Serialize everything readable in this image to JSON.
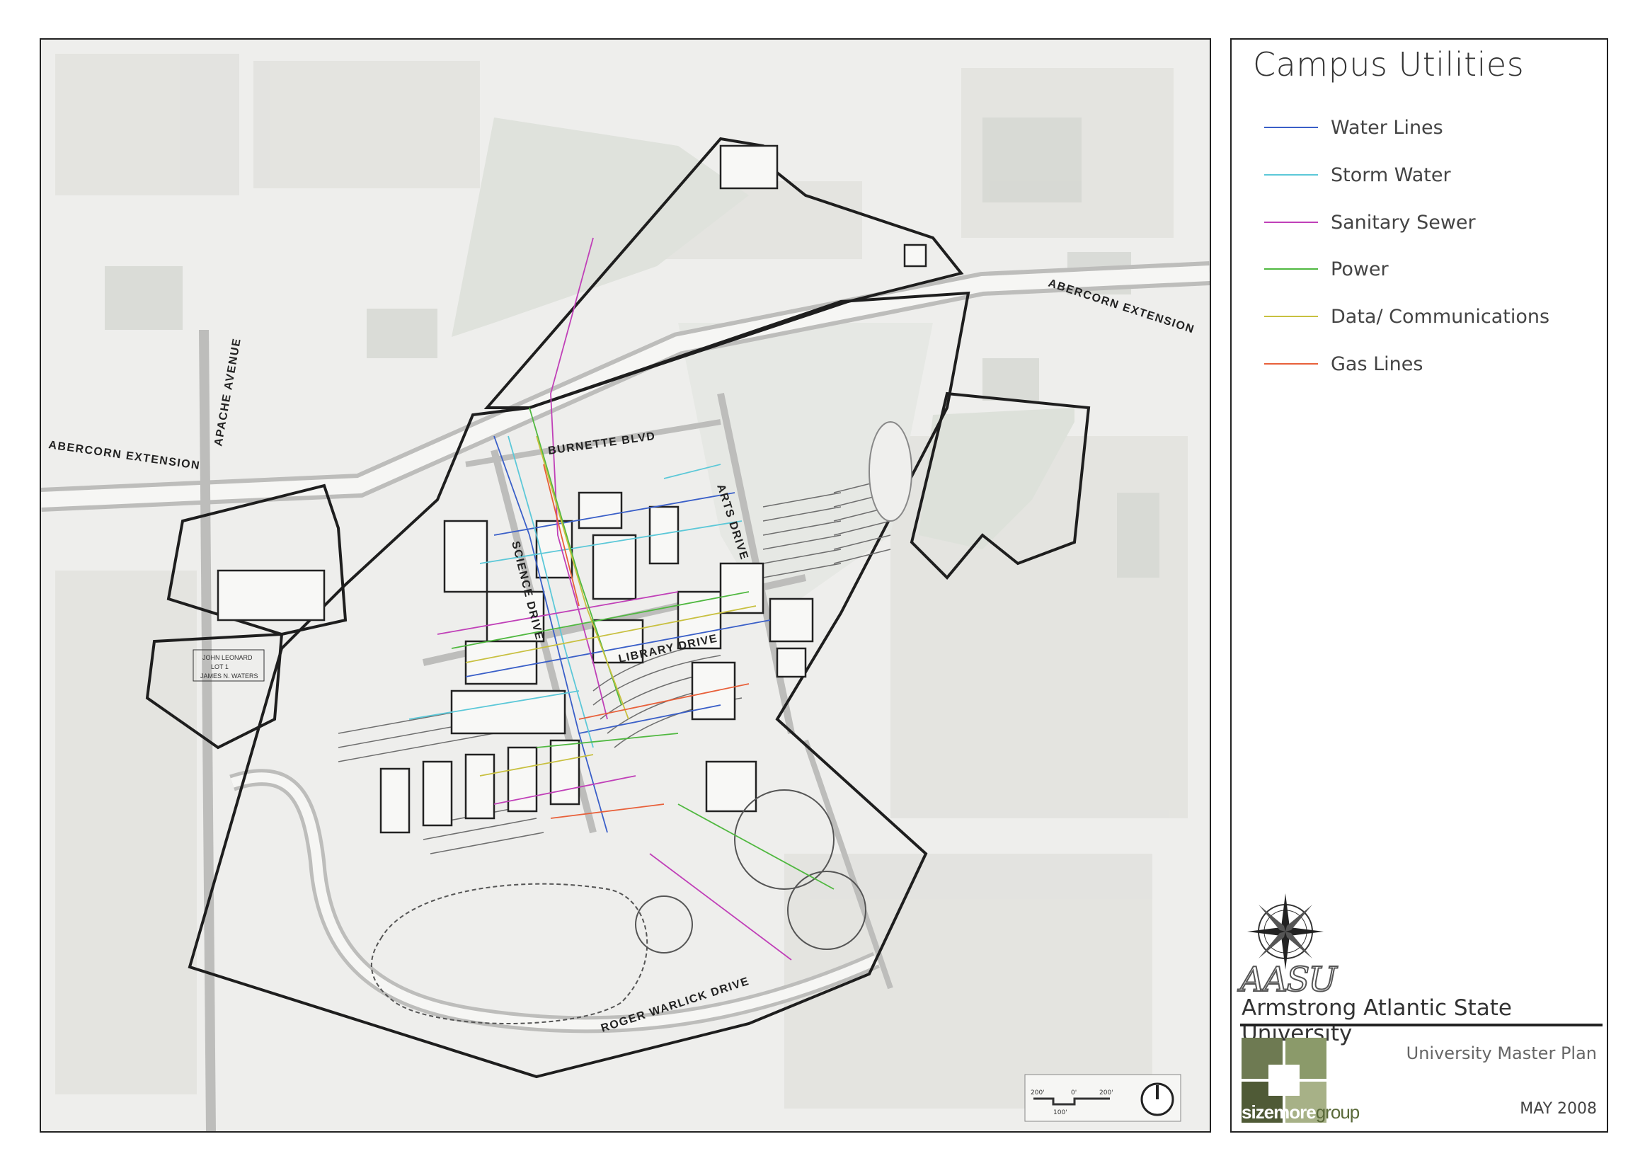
{
  "map": {
    "road_labels": {
      "abercorn_west": "ABERCORN EXTENSION",
      "abercorn_east": "ABERCORN EXTENSION",
      "apache": "APACHE AVENUE",
      "burnette": "BURNETTE BLVD",
      "arts": "ARTS DRIVE",
      "science": "SCIENCE DRIVE",
      "library": "LIBRARY DRIVE",
      "roger_warlick": "ROGER WARLICK DRIVE"
    },
    "parcel_labels": [
      "JOHN LEONARD",
      "LOT 1",
      "JAMES N. WATERS"
    ],
    "scale_bar": {
      "labels": [
        "200'",
        "0'",
        "200'",
        "100'"
      ]
    }
  },
  "legend": {
    "title": "Campus Utilities",
    "items": [
      {
        "label": "Water Lines",
        "color": "#3a5fc8"
      },
      {
        "label": "Storm Water",
        "color": "#5cc8d8"
      },
      {
        "label": "Sanitary Sewer",
        "color": "#c040b8"
      },
      {
        "label": "Power",
        "color": "#50b840"
      },
      {
        "label": "Data/ Communications",
        "color": "#c8c040"
      },
      {
        "label": "Gas Lines",
        "color": "#e8603a"
      }
    ]
  },
  "branding": {
    "logo_text": "AASU",
    "university": "Armstrong Atlantic State University",
    "firm_name_part1": "sizemore",
    "firm_name_part2": "group",
    "plan_title": "University Master Plan",
    "date": "MAY 2008"
  }
}
